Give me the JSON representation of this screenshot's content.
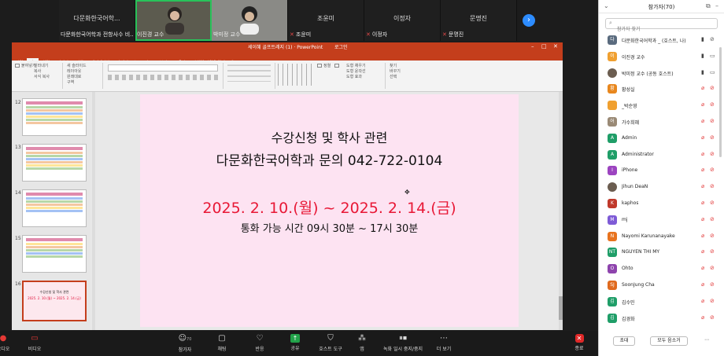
{
  "strip": {
    "tiles": [
      {
        "name": "다문화한국어학...",
        "caption": "다문화한국어학과 전항사수 비..."
      },
      {
        "caption": "이진경 교수"
      },
      {
        "caption": "박미정 교수"
      },
      {
        "name": "조윤미",
        "caption": "조윤미"
      },
      {
        "name": "이정자",
        "caption": "이정자"
      },
      {
        "name": "문명진",
        "caption": "문명진"
      }
    ],
    "next_icon": "chevron-right-icon"
  },
  "ppt": {
    "title": "세이혜 골프트레지 (1) · PowerPoint",
    "signin": "로그인",
    "tabs": [
      "파일",
      "홈",
      "삽입",
      "디자인",
      "전환",
      "애니메이션",
      "슬라이드 쇼",
      "검토",
      "보기",
      "도움말",
      "수행할 작업을 알려 주세요"
    ],
    "ribbon": {
      "paste": "붙여넣기",
      "clip": [
        "잘라내기",
        "복사",
        "서식 복사"
      ],
      "slide": [
        "새 슬라이드",
        "레이아웃",
        "원래대로",
        "구역"
      ],
      "arrange": "정렬",
      "edit": [
        "찾기",
        "바꾸기",
        "선택"
      ],
      "shape": [
        "도형 채우기",
        "도형 윤곽선",
        "도형 효과"
      ]
    },
    "thumb_numbers": [
      "12",
      "13",
      "14",
      "15",
      "16"
    ],
    "thumb_mini": {
      "line1": "수강신청 및 학사 관련",
      "line2": "2025. 2. 10.(월) ~ 2025. 2. 14.(금)"
    },
    "slide": {
      "line1": "수강신청 및 학사 관련",
      "line2": "다문화한국어학과 문의 042-722-0104",
      "line3": "2025. 2. 10.(월) ~ 2025. 2. 14.(금)",
      "line4": "통화 가능 시간 09시 30분 ~ 17시 30분"
    }
  },
  "toolbar": {
    "items": [
      {
        "label": "오디오",
        "icon": "microphone-icon"
      },
      {
        "label": "비디오",
        "icon": "video-off-icon"
      },
      {
        "label": "참가자",
        "icon": "participants-icon",
        "count": "70"
      },
      {
        "label": "채팅",
        "icon": "chat-icon"
      },
      {
        "label": "반응",
        "icon": "reaction-icon"
      },
      {
        "label": "공유",
        "icon": "share-icon"
      },
      {
        "label": "호스트 도구",
        "icon": "shield-icon"
      },
      {
        "label": "앱",
        "icon": "apps-icon"
      },
      {
        "label": "녹화 일시 중지/중지",
        "icon": "record-pause-icon"
      },
      {
        "label": "더 보기",
        "icon": "more-icon"
      },
      {
        "label": "종료",
        "icon": "end-icon"
      }
    ]
  },
  "panel": {
    "title": "참가자(70)",
    "search_placeholder": "참가자 찾기",
    "participants": [
      {
        "initial": "다",
        "color": "#5a6b7e",
        "name": "다문화한국어학과 _ (호스트, 나)"
      },
      {
        "initial": "이",
        "color": "#f0a030",
        "name": "이진경 교수"
      },
      {
        "initial": "",
        "color": "",
        "name": "박미정 교수 (공동 호스트)"
      },
      {
        "initial": "황",
        "color": "#e8871e",
        "name": "황성실"
      },
      {
        "initial": "",
        "color": "#f0a030",
        "name": "_박순영"
      },
      {
        "initial": "어",
        "color": "#9a8a76",
        "name": "가수희혜"
      },
      {
        "initial": "A",
        "color": "#1f9e68",
        "name": "Admin"
      },
      {
        "initial": "A",
        "color": "#1f9e68",
        "name": "Administrator"
      },
      {
        "initial": "I",
        "color": "#9c44c0",
        "name": "iPhone"
      },
      {
        "initial": "",
        "color": "",
        "name": "Jihun DeaN"
      },
      {
        "initial": "K",
        "color": "#c0392b",
        "name": "kaphos"
      },
      {
        "initial": "M",
        "color": "#7e5bd6",
        "name": "mj"
      },
      {
        "initial": "N",
        "color": "#e8731e",
        "name": "Nayomi Karunanayake"
      },
      {
        "initial": "NT",
        "color": "#1f9e68",
        "name": "NGUYEN THI MY"
      },
      {
        "initial": "O",
        "color": "#8e44ad",
        "name": "Ohto"
      },
      {
        "initial": "SJ",
        "color": "#e06a1e",
        "name": "SoonJung Cha"
      },
      {
        "initial": "김",
        "color": "#1f9e68",
        "name": "김수민"
      },
      {
        "initial": "김",
        "color": "#1f9e68",
        "name": "김경화"
      }
    ],
    "invite": "초대",
    "mute_all": "모두 음소거"
  }
}
